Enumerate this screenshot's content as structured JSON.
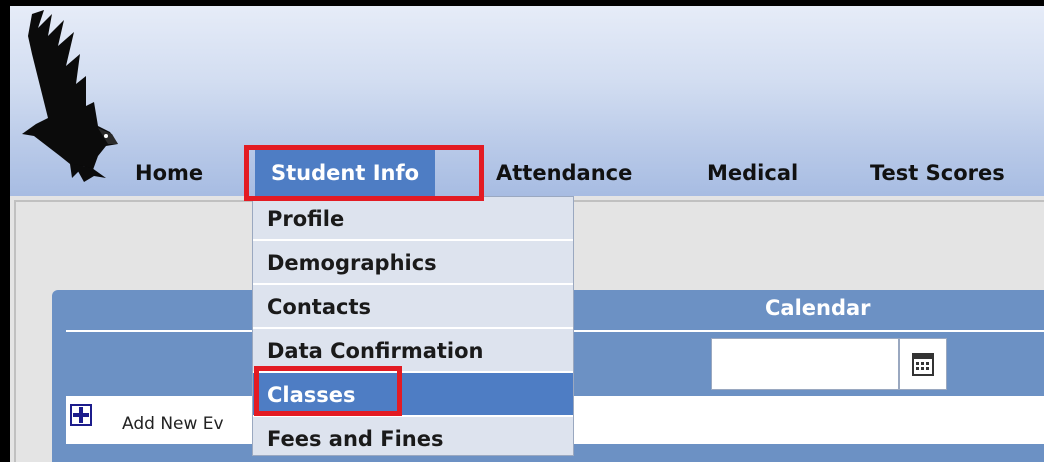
{
  "nav": {
    "items": [
      {
        "label": "Home"
      },
      {
        "label": "Student Info"
      },
      {
        "label": "Attendance"
      },
      {
        "label": "Medical"
      },
      {
        "label": "Test Scores"
      }
    ]
  },
  "dropdown": {
    "items": [
      {
        "label": "Profile"
      },
      {
        "label": "Demographics"
      },
      {
        "label": "Contacts"
      },
      {
        "label": "Data Confirmation"
      },
      {
        "label": "Classes"
      },
      {
        "label": "Fees and Fines"
      }
    ]
  },
  "calendar": {
    "title": "Calendar",
    "date_value": "",
    "icon": "calendar-icon"
  },
  "events": {
    "add_label": "Add New Ev",
    "icon": "add-icon"
  },
  "colors": {
    "accent": "#4e7dc4",
    "panel": "#6c91c4",
    "highlight": "#e31b23"
  }
}
